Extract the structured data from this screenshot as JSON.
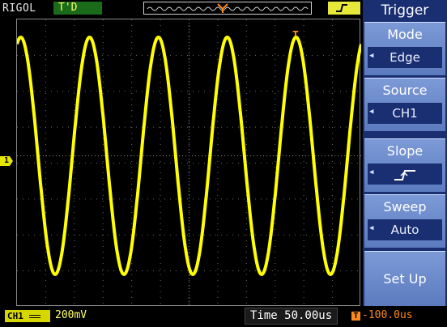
{
  "topbar": {
    "brand": "RIGOL",
    "status": "T'D"
  },
  "menu": {
    "title": "Trigger",
    "items": [
      {
        "label": "Mode",
        "value": "Edge"
      },
      {
        "label": "Source",
        "value": "CH1"
      },
      {
        "label": "Slope",
        "value": "rising-edge"
      },
      {
        "label": "Sweep",
        "value": "Auto"
      },
      {
        "label": "Set Up",
        "value": ""
      }
    ]
  },
  "channel": {
    "badge": "CH1",
    "marker": "1",
    "scale": "200mV",
    "color": "#ffff00"
  },
  "bottombar": {
    "timebase": "Time 50.00us",
    "trigger_offset": "-100.0us"
  },
  "waveform": {
    "cycles": 5.0,
    "amplitude_div": 3.3,
    "frequency_hint": "sine"
  }
}
